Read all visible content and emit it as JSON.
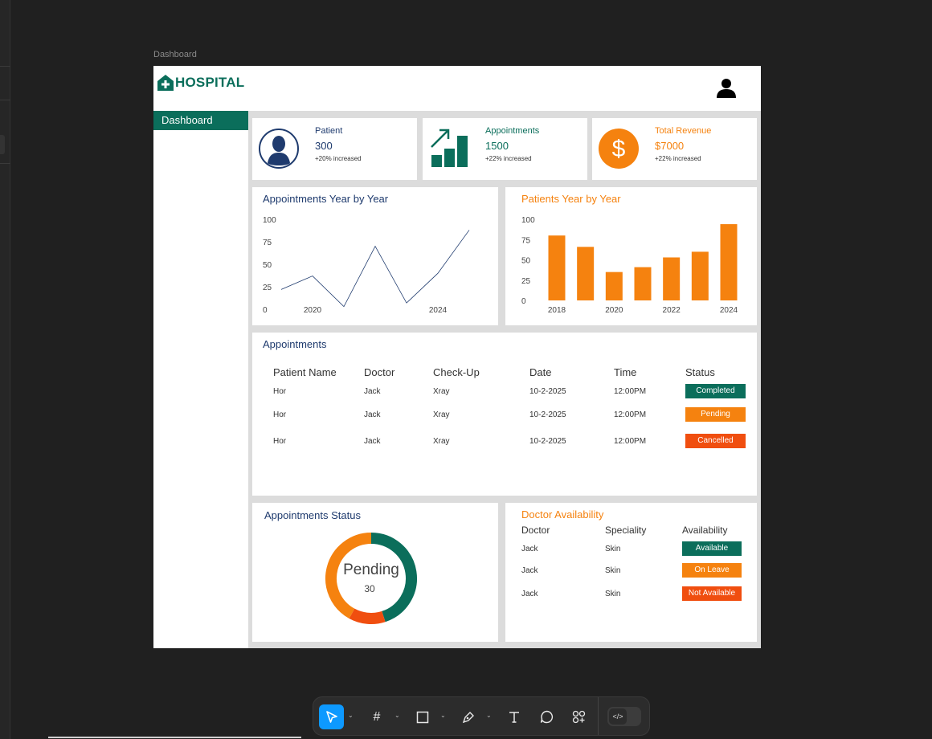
{
  "frame": {
    "label": "Dashboard"
  },
  "brand": {
    "name": "HOSPITAL",
    "primary": "#0b6e5b",
    "accent": "#f5820f",
    "danger": "#f04e0f",
    "navy": "#1f3b6e"
  },
  "sidebar": {
    "items": [
      {
        "label": "Dashboard",
        "active": true
      }
    ]
  },
  "stats": [
    {
      "label": "Patient",
      "value": "300",
      "delta": "+20% increased",
      "icon": "person-icon"
    },
    {
      "label": "Appointments",
      "value": "1500",
      "delta": "+22% increased",
      "icon": "growth-chart-icon"
    },
    {
      "label": "Total Revenue",
      "value": "$7000",
      "delta": "+22% increased",
      "icon": "dollar-icon"
    }
  ],
  "chart_data": [
    {
      "type": "line",
      "title": "Appointments Year by Year",
      "x": [
        2019,
        2020,
        2021,
        2022,
        2023,
        2024,
        2025
      ],
      "y": [
        22,
        37,
        3,
        70,
        7,
        40,
        88
      ],
      "x_ticks": [
        "2020",
        "2024"
      ],
      "y_ticks": [
        "100",
        "75",
        "50",
        "25",
        "0"
      ],
      "ylim": [
        0,
        100
      ],
      "color": "#1f3b6e"
    },
    {
      "type": "bar",
      "title": "Patients Year by Year",
      "categories": [
        "2018",
        "2019",
        "2020",
        "2021",
        "2022",
        "2023",
        "2024"
      ],
      "values": [
        80,
        66,
        35,
        41,
        53,
        60,
        94
      ],
      "x_ticks": [
        "2018",
        "2020",
        "2022",
        "2024"
      ],
      "y_ticks": [
        "100",
        "75",
        "50",
        "25",
        "0"
      ],
      "ylim": [
        0,
        100
      ],
      "color": "#f5820f"
    },
    {
      "type": "pie",
      "title": "Appointments Status",
      "center_label": "Pending",
      "center_value": "30",
      "slices": [
        {
          "value": 45,
          "color": "#0b6e5b"
        },
        {
          "value": 13,
          "color": "#f04e0f"
        },
        {
          "value": 42,
          "color": "#f5820f"
        }
      ]
    }
  ],
  "appointments": {
    "title": "Appointments",
    "columns": [
      "Patient Name",
      "Doctor",
      "Check-Up",
      "Date",
      "Time",
      "Status"
    ],
    "rows": [
      {
        "patient": "Hor",
        "doctor": "Jack",
        "checkup": "Xray",
        "date": "10-2-2025",
        "time": "12:00PM",
        "status": "Completed",
        "color": "#0b6e5b"
      },
      {
        "patient": "Hor",
        "doctor": "Jack",
        "checkup": "Xray",
        "date": "10-2-2025",
        "time": "12:00PM",
        "status": "Pending",
        "color": "#f5820f"
      },
      {
        "patient": "Hor",
        "doctor": "Jack",
        "checkup": "Xray",
        "date": "10-2-2025",
        "time": "12:00PM",
        "status": "Cancelled",
        "color": "#f04e0f"
      }
    ]
  },
  "doctors": {
    "title": "Doctor Availability",
    "columns": [
      "Doctor",
      "Speciality",
      "Availability"
    ],
    "rows": [
      {
        "doctor": "Jack",
        "speciality": "Skin",
        "availability": "Available",
        "color": "#0b6e5b"
      },
      {
        "doctor": "Jack",
        "speciality": "Skin",
        "availability": "On Leave",
        "color": "#f5820f"
      },
      {
        "doctor": "Jack",
        "speciality": "Skin",
        "availability": "Not Available",
        "color": "#f04e0f"
      }
    ]
  },
  "toolbar": {
    "tools": [
      "move-tool",
      "frame-tool",
      "shape-tool",
      "pen-tool",
      "text-tool",
      "comment-tool",
      "actions-tool"
    ],
    "active": "move-tool"
  }
}
